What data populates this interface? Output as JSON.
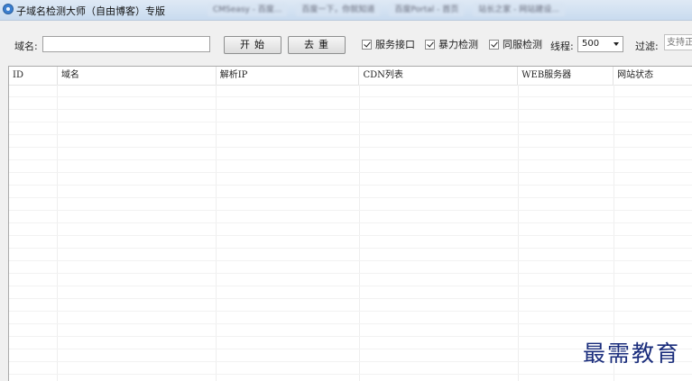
{
  "window": {
    "title": "子域名检测大师（自由博客）专版",
    "taskbar_tabs": [
      "CMSeasy - 百度...",
      "百度一下，你就知道",
      "百度Portal - 首页",
      "站长之家 - 网站建设..."
    ]
  },
  "toolbar": {
    "domain_label": "域名:",
    "domain_value": "",
    "start_label": "开始",
    "dedupe_label": "去重",
    "check_service_label": "服务接口",
    "check_service": true,
    "check_brute_label": "暴力检测",
    "check_brute": true,
    "check_same_server_label": "同服检测",
    "check_same_server": true,
    "threads_label": "线程:",
    "threads_value": "500",
    "filter_label": "过滤:",
    "filter_placeholder": "支持正"
  },
  "table": {
    "columns": [
      "ID",
      "域名",
      "解析IP",
      "CDN列表",
      "WEB服务器",
      "网站状态"
    ],
    "rows": []
  },
  "watermark": "最需教育"
}
